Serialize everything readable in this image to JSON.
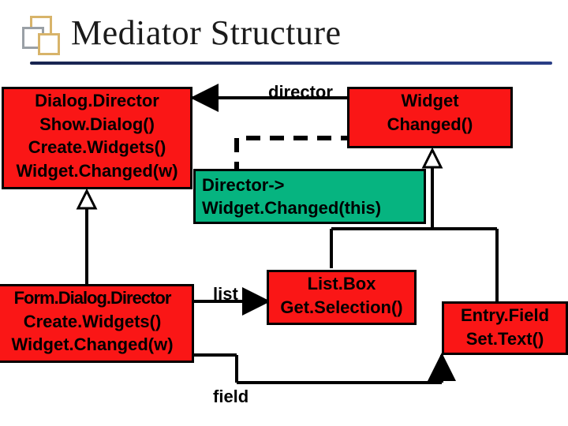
{
  "slide": {
    "title": "Mediator Structure"
  },
  "labels": {
    "director": "director",
    "list": "list",
    "field": "field"
  },
  "classes": {
    "dialogDirector": {
      "name": "Dialog.Director",
      "ops": [
        "Show.Dialog()",
        "Create.Widgets()",
        "Widget.Changed(w)"
      ]
    },
    "widget": {
      "name": "Widget",
      "ops": [
        "Changed()"
      ]
    },
    "formDialogDirector": {
      "name": "Form.Dialog.Director",
      "ops": [
        "Create.Widgets()",
        "Widget.Changed(w)"
      ]
    },
    "listBox": {
      "name": "List.Box",
      "ops": [
        "Get.Selection()"
      ]
    },
    "entryField": {
      "name": "Entry.Field",
      "ops": [
        "Set.Text()"
      ]
    }
  },
  "note": {
    "line1": "Director->",
    "line2": "Widget.Changed(this)"
  }
}
